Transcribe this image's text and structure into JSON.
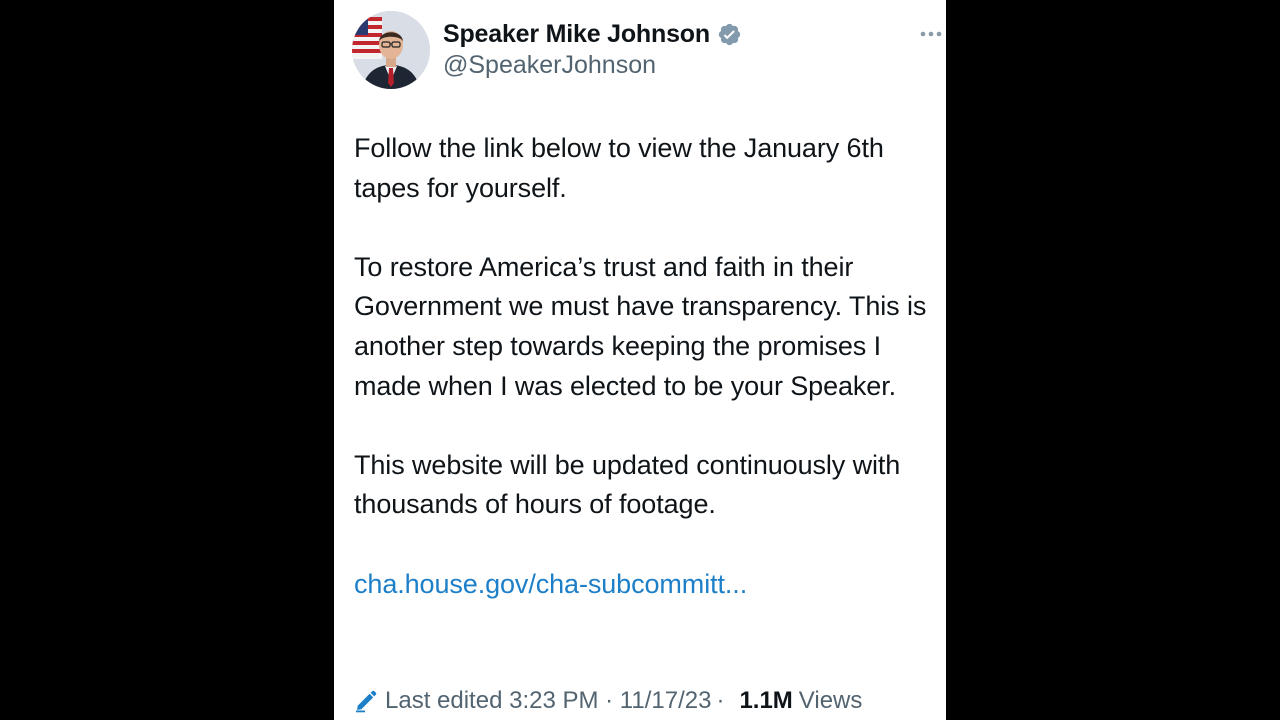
{
  "tweet": {
    "author": {
      "display_name": "Speaker Mike Johnson",
      "handle": "@SpeakerJohnson",
      "verified_icon": "verified-badge-icon",
      "verified_color": "#829aab"
    },
    "paragraphs": [
      "Follow the link below to view the January 6th tapes for yourself.",
      "To restore America’s trust and faith in their Government we must have transparency. This is another step towards keeping the promises I made when I was elected to be your Speaker.",
      "This website will be updated continuously with thousands of hours of footage."
    ],
    "link_text": "cha.house.gov/cha-subcommitt...",
    "link_color": "#1d7fc8",
    "meta": {
      "edited_label": "Last edited 3:23 PM · 11/17/23",
      "separator": "·",
      "views_count": "1.1M",
      "views_label": "Views"
    }
  },
  "colors": {
    "background": "#000000",
    "card": "#ffffff",
    "text_primary": "#0f1419",
    "text_secondary": "#536471"
  }
}
